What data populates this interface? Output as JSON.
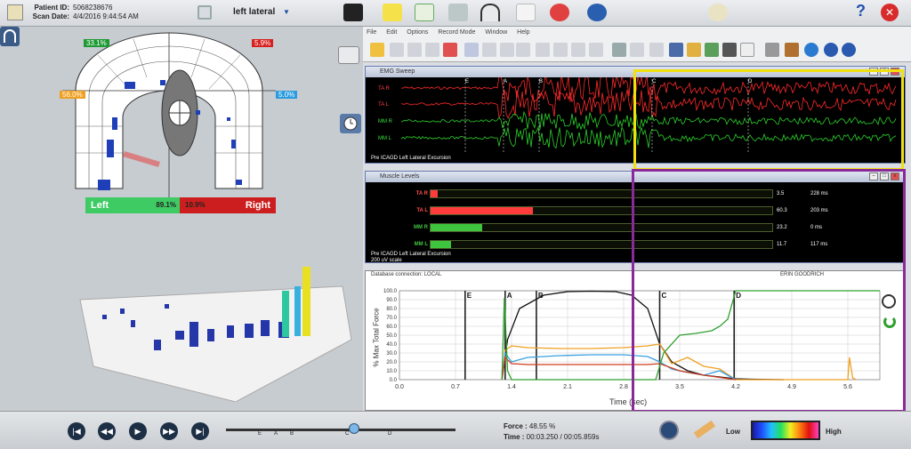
{
  "header": {
    "patient_id_label": "Patient ID:",
    "patient_id": "5068238676",
    "scan_date_label": "Scan Date:",
    "scan_date": "4/4/2016 9:44:54 AM",
    "mode": "left lateral",
    "mode_arrow": "▼",
    "help": "?",
    "close": "✕"
  },
  "arch": {
    "top_left_pct": "33.1%",
    "top_right_pct": "5.9%",
    "mid_left_pct": "56.0%",
    "mid_right_pct": "5.0%",
    "left_label": "Left",
    "left_value": "89.1%",
    "right_value": "10.9%",
    "right_label": "Right",
    "top_left_color": "#1e9a34",
    "top_right_color": "#d72020",
    "mid_left_color": "#f0a020",
    "mid_right_color": "#2a9be0"
  },
  "menu": [
    "File",
    "Edit",
    "Options",
    "Record Mode",
    "Window",
    "Help"
  ],
  "emg": {
    "title": "EMG Sweep",
    "channels": [
      {
        "label": "TA R",
        "color": "#ff2a2a"
      },
      {
        "label": "TA L",
        "color": "#ff2a2a"
      },
      {
        "label": "MM R",
        "color": "#2bd12b"
      },
      {
        "label": "MM L",
        "color": "#2bd12b"
      }
    ],
    "markers": [
      "E",
      "A",
      "B",
      "C",
      "D"
    ],
    "caption": "Pre ICAGD Left Lateral Excursion"
  },
  "muscle": {
    "title": "Muscle Levels",
    "rows": [
      {
        "label": "TA R",
        "color": "#ff3b3b",
        "level": 0.02,
        "value": "3.5",
        "ms": "228 ms"
      },
      {
        "label": "TA L",
        "color": "#ff3b3b",
        "level": 0.3,
        "value": "60.3",
        "ms": "203 ms"
      },
      {
        "label": "MM R",
        "color": "#3ec43e",
        "level": 0.15,
        "value": "23.2",
        "ms": "0 ms"
      },
      {
        "label": "MM L",
        "color": "#3ec43e",
        "level": 0.06,
        "value": "11.7",
        "ms": "117 ms"
      }
    ],
    "caption": "Pre ICAGD Left Lateral Excursion",
    "scale": "200 uV scale"
  },
  "force": {
    "db_label": "Database connection: LOCAL",
    "user": "ERIN GOODRICH",
    "ylabel": "% Max Total Force",
    "xlabel": "Time (sec)"
  },
  "chart_data": {
    "type": "line",
    "xlabel": "Time (sec)",
    "ylabel": "% Max Total Force",
    "xlim": [
      0,
      6.0
    ],
    "ylim": [
      0,
      100
    ],
    "xticks": [
      "0.0",
      "0.7",
      "1.4",
      "2.1",
      "2.8",
      "3.5",
      "4.2",
      "4.9",
      "5.6"
    ],
    "yticks": [
      "0.0",
      "10.0",
      "20.0",
      "30.0",
      "40.0",
      "50.0",
      "60.0",
      "70.0",
      "80.0",
      "90.0",
      "100.0"
    ],
    "markers": [
      {
        "label": "E",
        "x": 0.82
      },
      {
        "label": "A",
        "x": 1.32
      },
      {
        "label": "B",
        "x": 1.71
      },
      {
        "label": "C",
        "x": 3.25
      },
      {
        "label": "D",
        "x": 4.18
      }
    ],
    "series": [
      {
        "color": "#111111",
        "x": [
          1.28,
          1.35,
          1.5,
          1.8,
          2.1,
          2.4,
          2.7,
          2.9,
          3.1,
          3.25,
          3.4,
          3.6,
          3.8,
          4.0,
          4.2,
          4.4,
          4.6,
          4.8
        ],
        "y": [
          0,
          45,
          80,
          95,
          99,
          99.5,
          99,
          95,
          80,
          40,
          20,
          10,
          5,
          3,
          1,
          0.5,
          0.2,
          0
        ]
      },
      {
        "color": "#f0a020",
        "x": [
          1.28,
          1.32,
          1.4,
          1.6,
          2.0,
          2.4,
          2.8,
          3.1,
          3.25,
          3.4,
          3.6,
          3.8,
          4.0,
          4.2,
          5.6,
          5.62,
          5.66,
          5.7
        ],
        "y": [
          0,
          33,
          38,
          36,
          35,
          35,
          36,
          38,
          40,
          18,
          25,
          15,
          12,
          0,
          0,
          25,
          2,
          0
        ]
      },
      {
        "color": "#3aa0e0",
        "x": [
          1.28,
          1.32,
          1.4,
          1.6,
          2.0,
          2.4,
          2.8,
          3.1,
          3.25,
          3.4,
          3.6,
          3.8,
          4.0,
          4.2
        ],
        "y": [
          0,
          30,
          20,
          25,
          27,
          28,
          28,
          26,
          20,
          12,
          8,
          5,
          10,
          0
        ]
      },
      {
        "color": "#d23a1e",
        "x": [
          1.28,
          1.32,
          1.4,
          1.6,
          2.0,
          2.4,
          2.8,
          3.1,
          3.25,
          3.5,
          3.8,
          4.2
        ],
        "y": [
          0,
          25,
          18,
          17,
          17,
          17,
          17,
          17,
          18,
          10,
          5,
          0
        ]
      },
      {
        "color": "#2ea02e",
        "x": [
          1.28,
          1.31,
          1.35,
          1.4,
          3.2,
          3.3,
          3.5,
          3.7,
          3.9,
          4.0,
          4.1,
          4.2,
          4.3,
          6.0
        ],
        "y": [
          0,
          92,
          10,
          0,
          0,
          30,
          50,
          52,
          55,
          60,
          68,
          100,
          100,
          100
        ]
      }
    ]
  },
  "playback": {
    "markers": [
      "E",
      "A",
      "B",
      "C",
      "D"
    ],
    "force_label": "Force :",
    "force_value": "48.55 %",
    "time_label": "Time :",
    "time_value": "00:03.250 / 00:05.859s",
    "low": "Low",
    "high": "High"
  }
}
